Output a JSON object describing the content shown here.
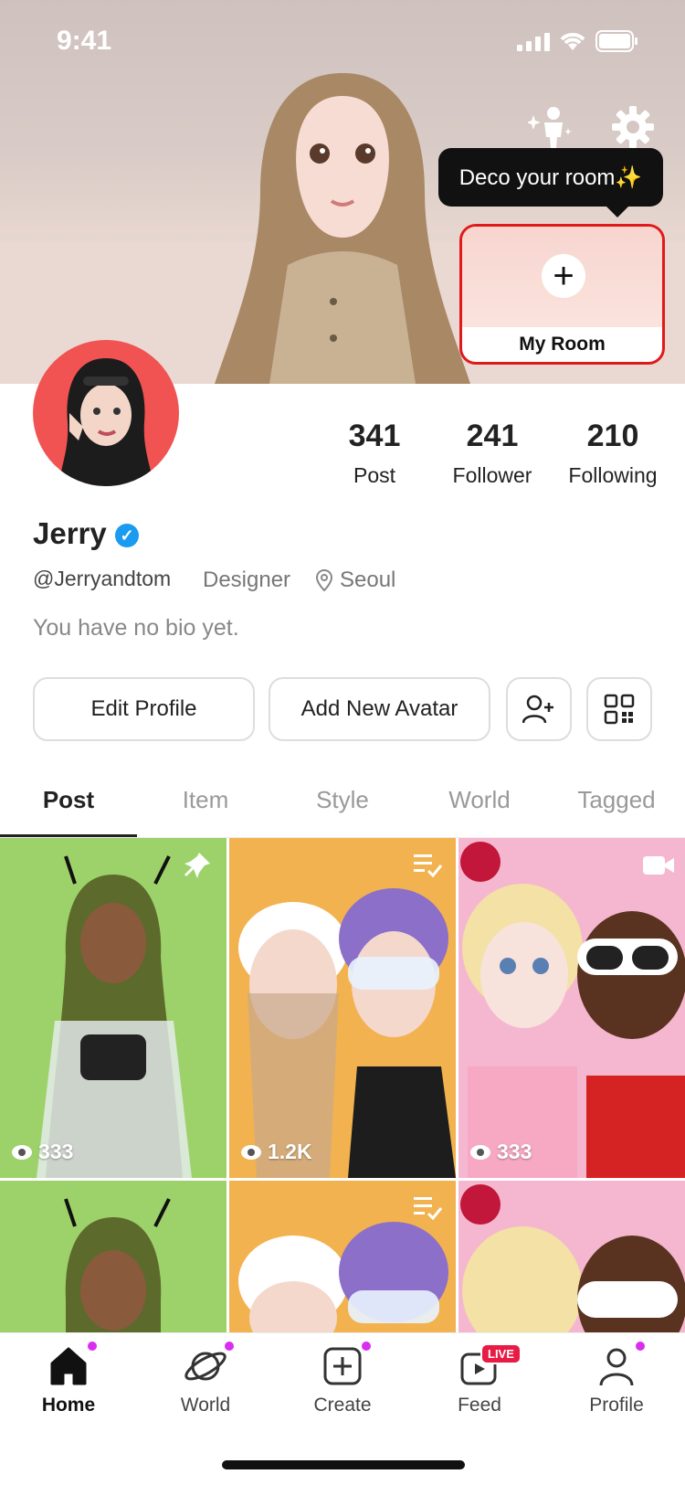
{
  "status_bar": {
    "time": "9:41"
  },
  "header": {
    "tooltip": "Deco your room✨",
    "my_room_label": "My Room"
  },
  "profile": {
    "name": "Jerry",
    "handle": "@Jerryandtom",
    "role": "Designer",
    "location": "Seoul",
    "bio": "You have no bio yet.",
    "stats": [
      {
        "value": "341",
        "label": "Post"
      },
      {
        "value": "241",
        "label": "Follower"
      },
      {
        "value": "210",
        "label": "Following"
      }
    ]
  },
  "actions": {
    "edit_profile": "Edit Profile",
    "add_avatar": "Add New Avatar"
  },
  "tabs": [
    {
      "label": "Post",
      "active": true
    },
    {
      "label": "Item",
      "active": false
    },
    {
      "label": "Style",
      "active": false
    },
    {
      "label": "World",
      "active": false
    },
    {
      "label": "Tagged",
      "active": false
    }
  ],
  "posts": [
    {
      "views": "333",
      "bg": "#9dd26a",
      "badge": "pin-icon"
    },
    {
      "views": "1.2K",
      "bg": "#f2b24f",
      "badge": "playlist-icon"
    },
    {
      "views": "333",
      "bg": "#f5b7cf",
      "badge": "video-icon"
    }
  ],
  "bottom_nav": [
    {
      "label": "Home",
      "active": true
    },
    {
      "label": "World",
      "active": false
    },
    {
      "label": "Create",
      "active": false
    },
    {
      "label": "Feed",
      "active": false,
      "badge": "LIVE"
    },
    {
      "label": "Profile",
      "active": false
    }
  ]
}
